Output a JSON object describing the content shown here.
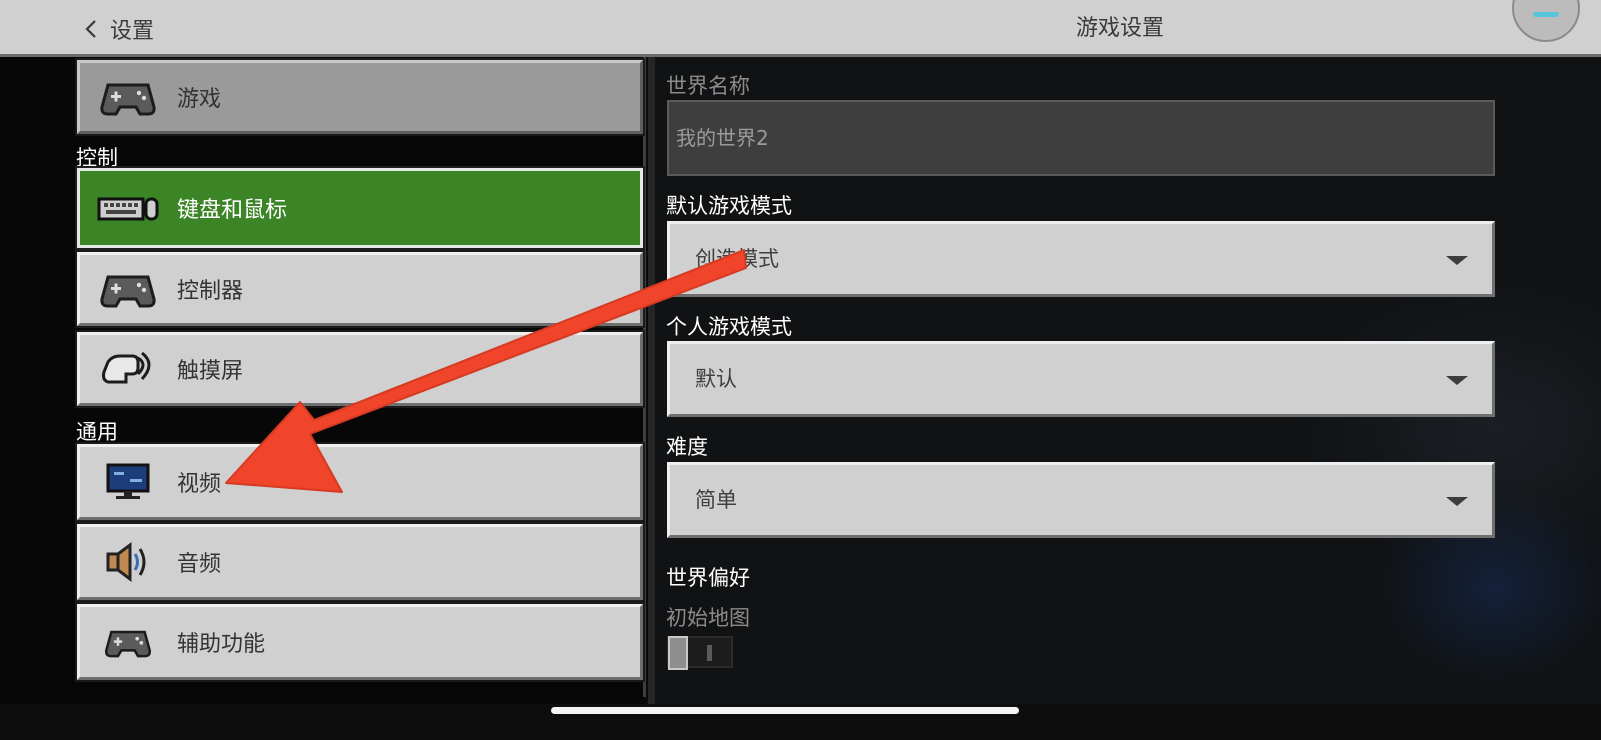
{
  "header": {
    "back_label": "设置",
    "title": "游戏设置"
  },
  "sidebar": {
    "items_top": [
      {
        "label": "游戏",
        "icon": "gamepad-icon"
      }
    ],
    "section_controls": "控制",
    "controls": [
      {
        "label": "键盘和鼠标",
        "icon": "keyboard-mouse-icon",
        "active": true
      },
      {
        "label": "控制器",
        "icon": "gamepad-icon",
        "active": false
      },
      {
        "label": "触摸屏",
        "icon": "touch-hand-icon",
        "active": false
      }
    ],
    "section_general": "通用",
    "general": [
      {
        "label": "视频",
        "icon": "monitor-icon"
      },
      {
        "label": "音频",
        "icon": "speaker-icon"
      },
      {
        "label": "辅助功能",
        "icon": "gamepad-icon"
      }
    ]
  },
  "settings": {
    "world_name_label": "世界名称",
    "world_name_value": "我的世界2",
    "default_mode_label": "默认游戏模式",
    "default_mode_value": "创造模式",
    "personal_mode_label": "个人游戏模式",
    "personal_mode_value": "默认",
    "difficulty_label": "难度",
    "difficulty_value": "简单",
    "world_prefs_label": "世界偏好",
    "starting_map_label": "初始地图",
    "starting_map_on": false
  },
  "colors": {
    "active_green": "#3c8527",
    "button_gray": "#d0d0d0",
    "annotation_red": "#f0452a"
  }
}
